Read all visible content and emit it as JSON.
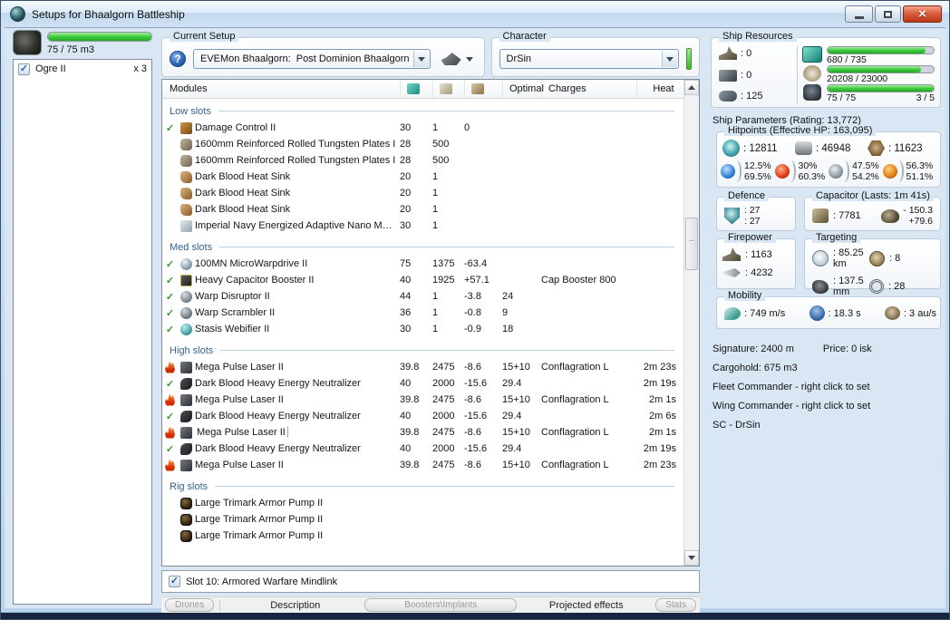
{
  "window": {
    "title": "Setups for Bhaalgorn Battleship"
  },
  "drones": {
    "capacity_text": "75 / 75 m3",
    "items": [
      {
        "name": "Ogre II",
        "count": "x 3",
        "checked": true
      }
    ]
  },
  "current_setup": {
    "label": "Current Setup",
    "value": "EVEMon Bhaalgorn:  Post Dominion Bhaalgorn"
  },
  "character": {
    "label": "Character",
    "value": "DrSin"
  },
  "ship_resources": {
    "label": "Ship Resources",
    "turrets": ": 0",
    "launchers": ": 0",
    "calibration": ": 125",
    "cpu_text": "680 / 735",
    "cpu_pct": 92.5,
    "pg_text": "20208 / 23000",
    "pg_pct": 88,
    "drone_text": "75 / 75",
    "drone_slots": "3 / 5",
    "drone_pct": 100
  },
  "modules": {
    "columns": {
      "name": "Modules",
      "optimal": "Optimal",
      "charges": "Charges",
      "heat": "Heat"
    },
    "groups": [
      {
        "label": "Low slots",
        "rows": [
          {
            "status": "ok",
            "icon": "damage-control",
            "name": "Damage Control II",
            "cpu": "30",
            "pg": "1",
            "cap": "0",
            "optimal": "",
            "charges": "",
            "heat": ""
          },
          {
            "status": "",
            "icon": "armor-plate",
            "name": "1600mm Reinforced Rolled Tungsten Plates I",
            "cpu": "28",
            "pg": "500",
            "cap": "",
            "optimal": "",
            "charges": "",
            "heat": ""
          },
          {
            "status": "",
            "icon": "armor-plate",
            "name": "1600mm Reinforced Rolled Tungsten Plates I",
            "cpu": "28",
            "pg": "500",
            "cap": "",
            "optimal": "",
            "charges": "",
            "heat": ""
          },
          {
            "status": "",
            "icon": "heat-sink",
            "name": "Dark Blood Heat Sink",
            "cpu": "20",
            "pg": "1",
            "cap": "",
            "optimal": "",
            "charges": "",
            "heat": ""
          },
          {
            "status": "",
            "icon": "heat-sink",
            "name": "Dark Blood Heat Sink",
            "cpu": "20",
            "pg": "1",
            "cap": "",
            "optimal": "",
            "charges": "",
            "heat": ""
          },
          {
            "status": "",
            "icon": "heat-sink",
            "name": "Dark Blood Heat Sink",
            "cpu": "20",
            "pg": "1",
            "cap": "",
            "optimal": "",
            "charges": "",
            "heat": ""
          },
          {
            "status": "",
            "icon": "nano-membrane",
            "name": "Imperial Navy Energized Adaptive Nano Mem...",
            "cpu": "30",
            "pg": "1",
            "cap": "",
            "optimal": "",
            "charges": "",
            "heat": ""
          }
        ]
      },
      {
        "label": "Med slots",
        "rows": [
          {
            "status": "ok",
            "icon": "mwd",
            "name": "100MN MicroWarpdrive II",
            "cpu": "75",
            "pg": "1375",
            "cap": "-63.4",
            "optimal": "",
            "charges": "",
            "heat": ""
          },
          {
            "status": "ok",
            "icon": "cap-booster",
            "name": "Heavy Capacitor Booster II",
            "cpu": "40",
            "pg": "1925",
            "cap": "+57.1",
            "optimal": "",
            "charges": "Cap Booster 800",
            "heat": ""
          },
          {
            "status": "ok",
            "icon": "warp-disruptor",
            "name": "Warp Disruptor II",
            "cpu": "44",
            "pg": "1",
            "cap": "-3.8",
            "optimal": "24",
            "charges": "",
            "heat": ""
          },
          {
            "status": "ok",
            "icon": "warp-scrambler",
            "name": "Warp Scrambler II",
            "cpu": "36",
            "pg": "1",
            "cap": "-0.8",
            "optimal": "9",
            "charges": "",
            "heat": ""
          },
          {
            "status": "ok",
            "icon": "stasis-web",
            "name": "Stasis Webifier II",
            "cpu": "30",
            "pg": "1",
            "cap": "-0.9",
            "optimal": "18",
            "charges": "",
            "heat": ""
          }
        ]
      },
      {
        "label": "High slots",
        "rows": [
          {
            "status": "overheat",
            "icon": "laser",
            "name": "Mega Pulse Laser II",
            "cpu": "39.8",
            "pg": "2475",
            "cap": "-8.6",
            "optimal": "15+10",
            "charges": "Conflagration L",
            "heat": "2m 23s"
          },
          {
            "status": "ok",
            "icon": "neutralizer",
            "name": "Dark Blood Heavy Energy Neutralizer",
            "cpu": "40",
            "pg": "2000",
            "cap": "-15.6",
            "optimal": "29.4",
            "charges": "",
            "heat": "2m 19s"
          },
          {
            "status": "overheat",
            "icon": "laser",
            "name": "Mega Pulse Laser II",
            "cpu": "39.8",
            "pg": "2475",
            "cap": "-8.6",
            "optimal": "15+10",
            "charges": "Conflagration L",
            "heat": "2m 1s"
          },
          {
            "status": "ok",
            "icon": "neutralizer",
            "name": "Dark Blood Heavy Energy Neutralizer",
            "cpu": "40",
            "pg": "2000",
            "cap": "-15.6",
            "optimal": "29.4",
            "charges": "",
            "heat": "2m 6s"
          },
          {
            "status": "overheat",
            "icon": "laser",
            "name": "Mega Pulse Laser II",
            "focused": true,
            "cpu": "39.8",
            "pg": "2475",
            "cap": "-8.6",
            "optimal": "15+10",
            "charges": "Conflagration L",
            "heat": "2m 1s"
          },
          {
            "status": "ok",
            "icon": "neutralizer",
            "name": "Dark Blood Heavy Energy Neutralizer",
            "cpu": "40",
            "pg": "2000",
            "cap": "-15.6",
            "optimal": "29.4",
            "charges": "",
            "heat": "2m 19s"
          },
          {
            "status": "overheat",
            "icon": "laser",
            "name": "Mega Pulse Laser II",
            "cpu": "39.8",
            "pg": "2475",
            "cap": "-8.6",
            "optimal": "15+10",
            "charges": "Conflagration L",
            "heat": "2m 23s"
          }
        ]
      },
      {
        "label": "Rig slots",
        "rows": [
          {
            "status": "",
            "icon": "rig",
            "name": "Large Trimark Armor Pump II",
            "cpu": "",
            "pg": "",
            "cap": "",
            "optimal": "",
            "charges": "",
            "heat": ""
          },
          {
            "status": "",
            "icon": "rig",
            "name": "Large Trimark Armor Pump II",
            "cpu": "",
            "pg": "",
            "cap": "",
            "optimal": "",
            "charges": "",
            "heat": ""
          },
          {
            "status": "",
            "icon": "rig",
            "name": "Large Trimark Armor Pump II",
            "cpu": "",
            "pg": "",
            "cap": "",
            "optimal": "",
            "charges": "",
            "heat": ""
          }
        ]
      }
    ]
  },
  "slot10": {
    "label": "Slot 10: Armored Warfare Mindlink",
    "checked": true
  },
  "bottom_bar": {
    "items": [
      {
        "label": "Drones",
        "kind": "button"
      },
      {
        "label": "Description",
        "kind": "label"
      },
      {
        "label": "Boosters\\Implants",
        "kind": "button-wide"
      },
      {
        "label": "Projected effects",
        "kind": "label"
      },
      {
        "label": "Stats",
        "kind": "button"
      }
    ]
  },
  "ship_parameters": {
    "label": "Ship Parameters (Rating: 13,772)",
    "hitpoints": {
      "label": "Hitpoints (Effective HP: 163,095)",
      "shield": ": 12811",
      "armor": ": 46948",
      "hull": ": 11623",
      "resists": [
        {
          "icon": "em",
          "line1": "12.5%",
          "line2": "69.5%"
        },
        {
          "icon": "thermal",
          "line1": "30%",
          "line2": "60.3%"
        },
        {
          "icon": "kinetic",
          "line1": "47.5%",
          "line2": "54.2%"
        },
        {
          "icon": "explosive",
          "line1": "56.3%",
          "line2": "51.1%"
        }
      ]
    },
    "defence": {
      "label": "Defence",
      "line1": ": 27",
      "line2": ": 27"
    },
    "capacitor": {
      "label": "Capacitor (Lasts: 1m 41s)",
      "amount": ": 7781",
      "delta1": "- 150.3",
      "delta2": "+79.6"
    },
    "firepower": {
      "label": "Firepower",
      "turret": ": 1163",
      "missile": ": 4232"
    },
    "targeting": {
      "label": "Targeting",
      "range": ": 85.25 km",
      "targets": ": 8",
      "scan_res": ": 137.5 mm",
      "sensor": ": 28"
    },
    "mobility": {
      "label": "Mobility",
      "speed": ": 749 m/s",
      "agility": ": 18.3 s",
      "warp": ": 3 au/s"
    },
    "info": {
      "signature": "Signature: 2400 m",
      "price": "Price: 0 isk",
      "cargohold": "Cargohold: 675 m3",
      "fleet": "Fleet Commander - right click to set",
      "wing": "Wing Commander - right click to set",
      "sc": "SC - DrSin"
    }
  },
  "colors": {
    "accent_green": "#3ecb3e",
    "group_header_blue": "#33618f",
    "close_red": "#bc3918"
  }
}
